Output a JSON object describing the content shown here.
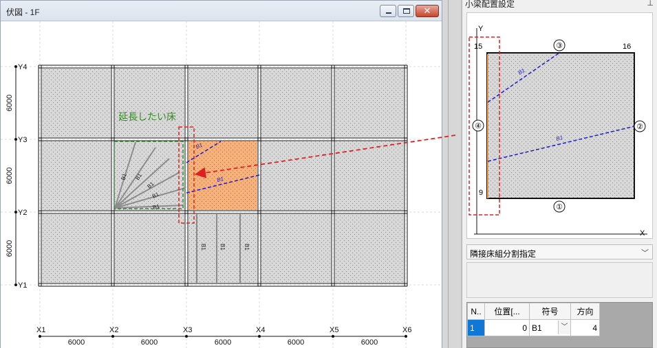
{
  "plan_window": {
    "title": "伏図 - 1F",
    "minimize_label": "",
    "maximize_label": "",
    "close_label": "✕"
  },
  "plan": {
    "x_axes": [
      "X1",
      "X2",
      "X3",
      "X4",
      "X5",
      "X6"
    ],
    "y_axes": [
      "Y4",
      "Y3",
      "Y2",
      "Y1"
    ],
    "x_spans": [
      "6000",
      "6000",
      "6000",
      "6000",
      "6000"
    ],
    "y_spans": [
      "6000",
      "6000",
      "6000"
    ],
    "annotation": "延長したい床",
    "beam_label": "B1",
    "highlight_color": "#f5b27c",
    "floor_fill": "#d8d8d8",
    "annotation_color": "#3a8a2a",
    "dash_color": "#e02020",
    "beam_dash_color": "#1a1ad0"
  },
  "panel": {
    "title": "小梁配置設定",
    "pin_icon": "pin-icon",
    "preview": {
      "axis_y": "Y",
      "axis_x": "X",
      "corner_tl": "15",
      "corner_tr": "16",
      "corner_bl": "9",
      "edge_bottom": "①",
      "edge_right": "②",
      "edge_top": "③",
      "edge_left": "④",
      "beam_label": "B1"
    },
    "dropdown_value": "隣接床組分割指定",
    "table": {
      "headers": [
        "N..",
        "位置[...",
        "符号",
        "方向"
      ],
      "rows": [
        {
          "no": "1",
          "pos": "0",
          "sign": "B1",
          "dir": "4"
        }
      ]
    }
  }
}
